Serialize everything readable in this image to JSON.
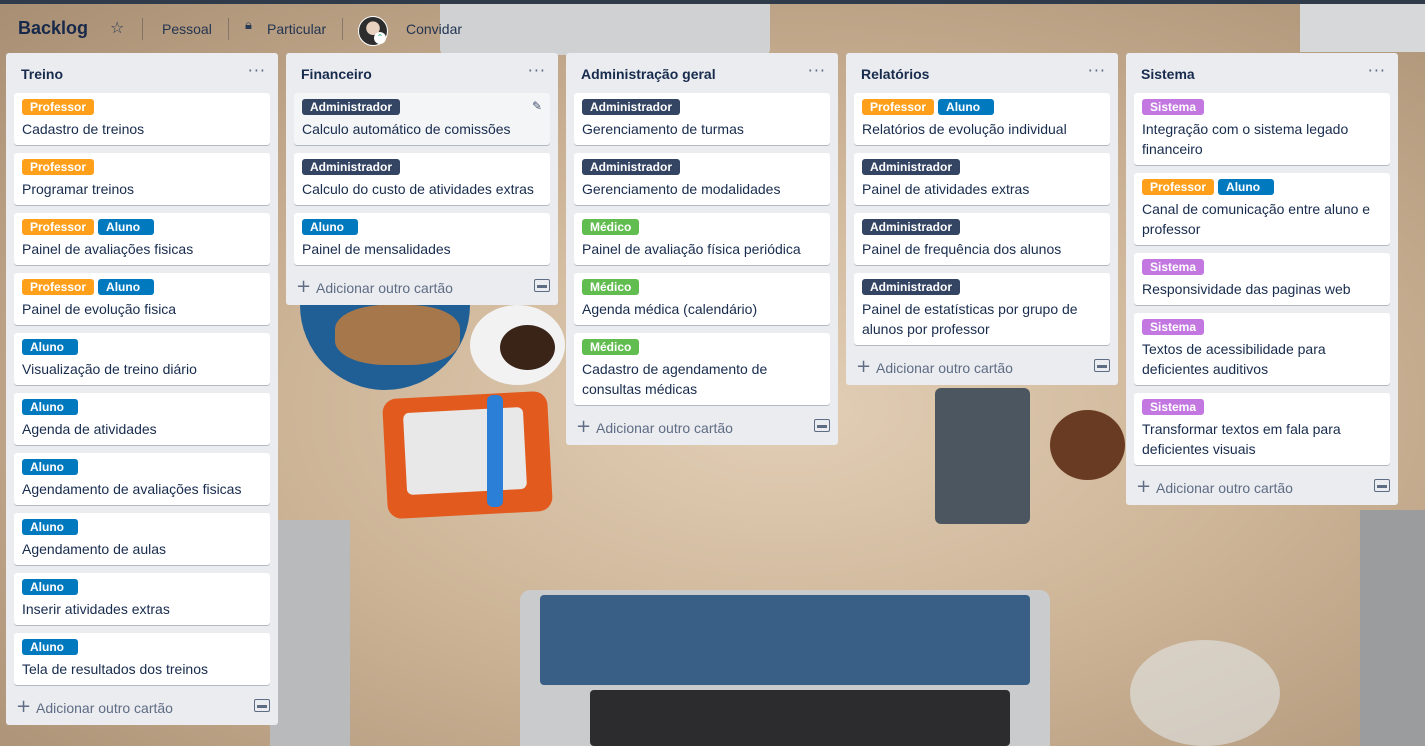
{
  "header": {
    "board_title": "Backlog",
    "team_label": "Pessoal",
    "visibility_label": "Particular",
    "invite_label": "Convidar"
  },
  "add_card_label": "Adicionar outro cartão",
  "label_colors": {
    "Professor": "#ff9f1a",
    "Aluno": "#0079bf",
    "Administrador": "#344563",
    "Médico": "#61bd4f",
    "Sistema": "#c377e0"
  },
  "lists": [
    {
      "title": "Treino",
      "cards": [
        {
          "labels": [
            "Professor"
          ],
          "title": "Cadastro de treinos"
        },
        {
          "labels": [
            "Professor"
          ],
          "title": "Programar treinos"
        },
        {
          "labels": [
            "Professor",
            "Aluno"
          ],
          "title": "Painel de avaliações fisicas"
        },
        {
          "labels": [
            "Professor",
            "Aluno"
          ],
          "title": "Painel de evolução fisica"
        },
        {
          "labels": [
            "Aluno"
          ],
          "title": "Visualização de treino diário"
        },
        {
          "labels": [
            "Aluno"
          ],
          "title": "Agenda de atividades"
        },
        {
          "labels": [
            "Aluno"
          ],
          "title": "Agendamento de avaliações fisicas"
        },
        {
          "labels": [
            "Aluno"
          ],
          "title": "Agendamento de aulas"
        },
        {
          "labels": [
            "Aluno"
          ],
          "title": "Inserir atividades extras"
        },
        {
          "labels": [
            "Aluno"
          ],
          "title": "Tela de resultados dos treinos"
        }
      ]
    },
    {
      "title": "Financeiro",
      "cards": [
        {
          "labels": [
            "Administrador"
          ],
          "title": "Calculo automático de comissões"
        },
        {
          "labels": [
            "Administrador"
          ],
          "title": "Calculo do custo de atividades extras"
        },
        {
          "labels": [
            "Aluno"
          ],
          "title": "Painel de mensalidades"
        }
      ]
    },
    {
      "title": "Administração geral",
      "cards": [
        {
          "labels": [
            "Administrador"
          ],
          "title": "Gerenciamento de turmas"
        },
        {
          "labels": [
            "Administrador"
          ],
          "title": "Gerenciamento de modalidades"
        },
        {
          "labels": [
            "Médico"
          ],
          "title": "Painel de avaliação física periódica"
        },
        {
          "labels": [
            "Médico"
          ],
          "title": "Agenda médica (calendário)"
        },
        {
          "labels": [
            "Médico"
          ],
          "title": "Cadastro de agendamento de consultas médicas"
        }
      ]
    },
    {
      "title": "Relatórios",
      "cards": [
        {
          "labels": [
            "Professor",
            "Aluno"
          ],
          "title": "Relatórios de evolução individual"
        },
        {
          "labels": [
            "Administrador"
          ],
          "title": "Painel de atividades extras"
        },
        {
          "labels": [
            "Administrador"
          ],
          "title": "Painel de frequência dos alunos"
        },
        {
          "labels": [
            "Administrador"
          ],
          "title": "Painel de estatísticas por grupo de alunos por professor"
        }
      ]
    },
    {
      "title": "Sistema",
      "cards": [
        {
          "labels": [
            "Sistema"
          ],
          "title": "Integração com o sistema legado financeiro"
        },
        {
          "labels": [
            "Professor",
            "Aluno"
          ],
          "title": "Canal de comunicação entre aluno e professor"
        },
        {
          "labels": [
            "Sistema"
          ],
          "title": "Responsividade das paginas web"
        },
        {
          "labels": [
            "Sistema"
          ],
          "title": "Textos de acessibilidade para deficientes auditivos"
        },
        {
          "labels": [
            "Sistema"
          ],
          "title": "Transformar textos em fala para deficientes visuais"
        }
      ]
    }
  ]
}
